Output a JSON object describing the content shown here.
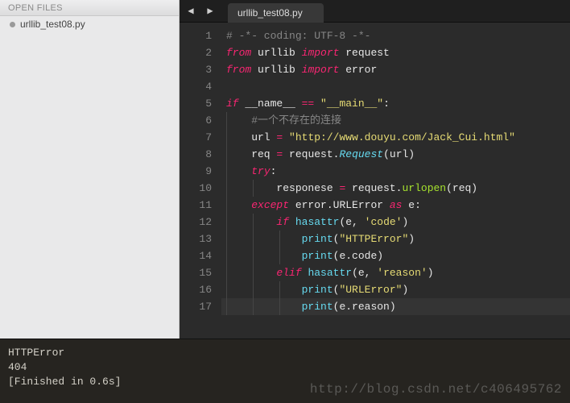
{
  "sidebar": {
    "header": "OPEN FILES",
    "items": [
      {
        "label": "urllib_test08.py"
      }
    ]
  },
  "tabbar": {
    "nav_prev": "◀",
    "nav_next": "▶",
    "tabs": [
      {
        "label": "urllib_test08.py"
      }
    ]
  },
  "code": {
    "lines": [
      [
        [
          "cmt",
          "# -*- coding: UTF-8 -*-"
        ]
      ],
      [
        [
          "kw",
          "from"
        ],
        [
          "id",
          " urllib "
        ],
        [
          "kw",
          "import"
        ],
        [
          "id",
          " request"
        ]
      ],
      [
        [
          "kw",
          "from"
        ],
        [
          "id",
          " urllib "
        ],
        [
          "kw",
          "import"
        ],
        [
          "id",
          " error"
        ]
      ],
      [],
      [
        [
          "kw",
          "if"
        ],
        [
          "id",
          " __name__ "
        ],
        [
          "op",
          "=="
        ],
        [
          "id",
          " "
        ],
        [
          "str",
          "\"__main__\""
        ],
        [
          "id",
          ":"
        ]
      ],
      [
        [
          "id",
          "    "
        ],
        [
          "cmt",
          "#一个不存在的连接"
        ]
      ],
      [
        [
          "id",
          "    url "
        ],
        [
          "op",
          "="
        ],
        [
          "id",
          " "
        ],
        [
          "str",
          "\"http://www.douyu.com/Jack_Cui.html\""
        ]
      ],
      [
        [
          "id",
          "    req "
        ],
        [
          "op",
          "="
        ],
        [
          "id",
          " request"
        ],
        [
          "id",
          "."
        ],
        [
          "cls",
          "Request"
        ],
        [
          "id",
          "("
        ],
        [
          "id",
          "url"
        ],
        [
          "id",
          ")"
        ]
      ],
      [
        [
          "id",
          "    "
        ],
        [
          "kw",
          "try"
        ],
        [
          "id",
          ":"
        ]
      ],
      [
        [
          "id",
          "        responese "
        ],
        [
          "op",
          "="
        ],
        [
          "id",
          " request"
        ],
        [
          "id",
          "."
        ],
        [
          "fn",
          "urlopen"
        ],
        [
          "id",
          "(req)"
        ]
      ],
      [
        [
          "id",
          "    "
        ],
        [
          "kw",
          "except"
        ],
        [
          "id",
          " error.URLError "
        ],
        [
          "kw",
          "as"
        ],
        [
          "id",
          " e:"
        ]
      ],
      [
        [
          "id",
          "        "
        ],
        [
          "kw",
          "if"
        ],
        [
          "id",
          " "
        ],
        [
          "builtin",
          "hasattr"
        ],
        [
          "id",
          "(e, "
        ],
        [
          "str",
          "'code'"
        ],
        [
          "id",
          ")"
        ]
      ],
      [
        [
          "id",
          "            "
        ],
        [
          "builtin",
          "print"
        ],
        [
          "id",
          "("
        ],
        [
          "str",
          "\"HTTPError\""
        ],
        [
          "id",
          ")"
        ]
      ],
      [
        [
          "id",
          "            "
        ],
        [
          "builtin",
          "print"
        ],
        [
          "id",
          "(e.code)"
        ]
      ],
      [
        [
          "id",
          "        "
        ],
        [
          "kw",
          "elif"
        ],
        [
          "id",
          " "
        ],
        [
          "builtin",
          "hasattr"
        ],
        [
          "id",
          "(e, "
        ],
        [
          "str",
          "'reason'"
        ],
        [
          "id",
          ")"
        ]
      ],
      [
        [
          "id",
          "            "
        ],
        [
          "builtin",
          "print"
        ],
        [
          "id",
          "("
        ],
        [
          "str",
          "\"URLError\""
        ],
        [
          "id",
          ")"
        ]
      ],
      [
        [
          "id",
          "            "
        ],
        [
          "builtin",
          "print"
        ],
        [
          "id",
          "(e.reason)"
        ]
      ]
    ],
    "active_line_index": 16
  },
  "console": {
    "lines": [
      "HTTPError",
      "404",
      "[Finished in 0.6s]"
    ]
  },
  "watermark": "http://blog.csdn.net/c406495762"
}
